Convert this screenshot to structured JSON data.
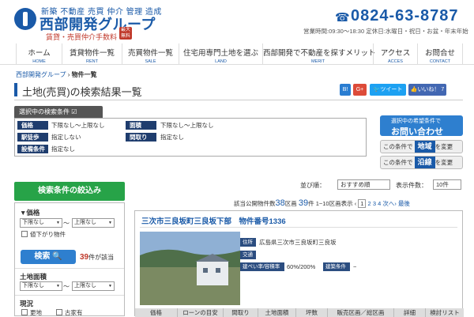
{
  "header": {
    "tagline": "新築 不動産 売買 仲介 管理 造成",
    "company": "西部開発グループ",
    "fee_text": "賃貸・売買仲介手数料",
    "fee_badge": "最大無料",
    "phone": "0824-63-8787",
    "hours": "営業時間:09:30〜18:30 定休日:水曜日・祝日・お盆・年末年始"
  },
  "nav": [
    {
      "jp": "ホーム",
      "en": "HOME"
    },
    {
      "jp": "賃貸物件一覧",
      "en": "RENT"
    },
    {
      "jp": "売買物件一覧",
      "en": "SALE"
    },
    {
      "jp": "住宅用専門土地を選ぶ",
      "en": "LAND"
    },
    {
      "jp": "西部開発で不動産を探すメリット",
      "en": "MERIT"
    },
    {
      "jp": "アクセス",
      "en": "ACCES"
    },
    {
      "jp": "お問合せ",
      "en": "CONTACT"
    }
  ],
  "breadcrumb": {
    "home": "西部開発グループ",
    "sep": "›",
    "current": "物件一覧"
  },
  "page_title": "土地(売買)の検索結果一覧",
  "share": {
    "hatena": "B!",
    "google": "G+",
    "tweet": "ツイート",
    "like": "いいね！ 7"
  },
  "conditions": {
    "tab": "選択中の検索条件",
    "price_label": "価格",
    "price_value": "下限なし〜上限なし",
    "area_label": "面積",
    "area_value": "下限なし〜上限なし",
    "walk_label": "駅徒歩",
    "walk_value": "指定しない",
    "layout_label": "間取り",
    "layout_value": "指定なし",
    "facility_label": "設備条件",
    "facility_value": "指定なし"
  },
  "cta": {
    "inquiry_l1": "選択中の希望条件で",
    "inquiry_l2": "お問い合わせ",
    "region_pre": "この条件で",
    "region_hl": "地域",
    "region_post": "を変更",
    "line_pre": "この条件で",
    "line_hl": "沿線",
    "line_post": "を変更"
  },
  "sidebar": {
    "heading": "検索条件の絞込み",
    "price_label": "▼価格",
    "price_min": "下限なし",
    "price_tilde": "〜",
    "price_max": "上限なし",
    "price_check": "値下がり物件",
    "search_btn": "検索",
    "count_num": "39",
    "count_suffix": "件が該当",
    "area_label": "土地面積",
    "area_min": "下限なし",
    "area_tilde": "〜",
    "area_max": "上限なし",
    "status_label": "現況",
    "status_opt1": "更地",
    "status_opt2": "古家有"
  },
  "results": {
    "sort_label": "並び順：",
    "sort_value": "おすすめ順",
    "per_label": "表示件数：",
    "per_value": "10件",
    "count_pre": "該当公開物件数",
    "count_num": "38",
    "count_mid": "区画",
    "count_num2": "39",
    "count_suf": "件",
    "range": "1−10区画表示",
    "pages": [
      "‹",
      "1",
      "2",
      "3",
      "4",
      "次へ›",
      "最後"
    ]
  },
  "card": {
    "title": "三次市三良坂町三良坂下部　物件番号1336",
    "addr_label": "住所",
    "addr_value": "広島県三次市三良坂町三良坂",
    "traffic_label": "交通",
    "ratio_label": "建ぺい率/容積率",
    "ratio_value": "60%/200%",
    "cond_label": "建築条件",
    "cond_value": "−",
    "headers": [
      "価格",
      "ローンの目安",
      "間取り",
      "土地面積",
      "坪数",
      "販売区画／総区画",
      "詳細",
      "検討リスト"
    ]
  },
  "colors": {
    "brand": "#1a5aa8",
    "green": "#27a348",
    "accent_red": "#c0392b"
  }
}
